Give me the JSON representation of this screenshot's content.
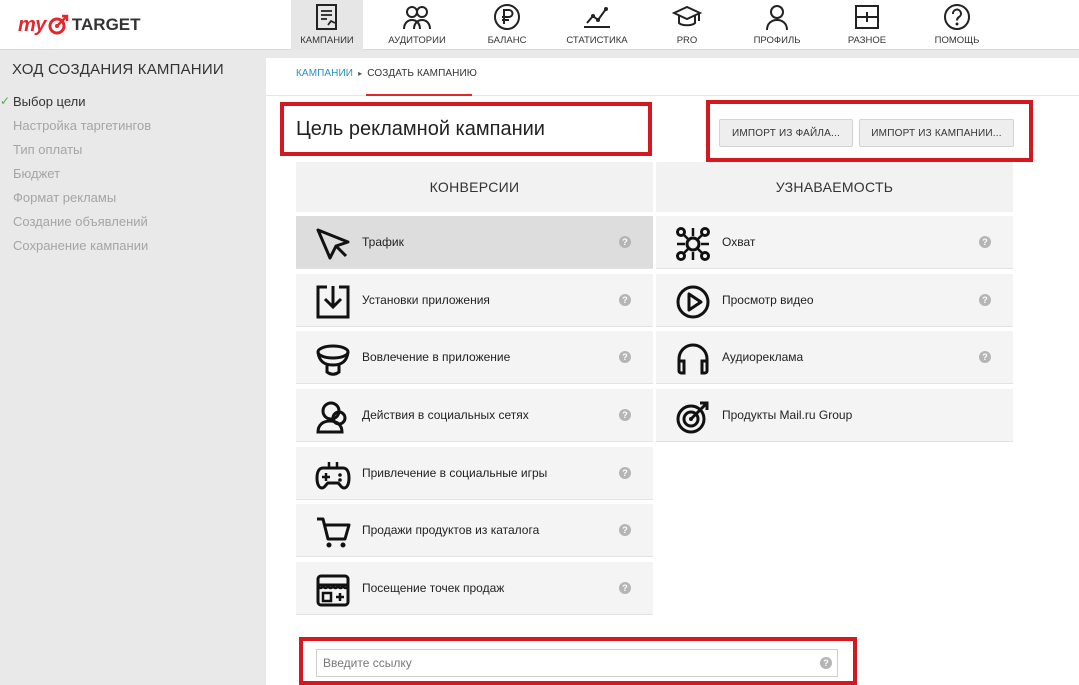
{
  "logo": {
    "my": "my",
    "target": "TARGET"
  },
  "nav": [
    {
      "label": "КАМПАНИИ",
      "icon": "campaigns-icon"
    },
    {
      "label": "АУДИТОРИИ",
      "icon": "audiences-icon"
    },
    {
      "label": "БАЛАНС",
      "icon": "ruble-icon"
    },
    {
      "label": "СТАТИСТИКА",
      "icon": "statistics-icon"
    },
    {
      "label": "PRO",
      "icon": "graduation-cap-icon"
    },
    {
      "label": "ПРОФИЛЬ",
      "icon": "profile-icon"
    },
    {
      "label": "РАЗНОЕ",
      "icon": "misc-icon"
    },
    {
      "label": "ПОМОЩЬ",
      "icon": "help-icon"
    }
  ],
  "sidebar": {
    "title": "ХОД СОЗДАНИЯ КАМПАНИИ",
    "steps": [
      {
        "label": "Выбор цели",
        "done": true
      },
      {
        "label": "Настройка таргетингов",
        "done": false
      },
      {
        "label": "Тип оплаты",
        "done": false
      },
      {
        "label": "Бюджет",
        "done": false
      },
      {
        "label": "Формат рекламы",
        "done": false
      },
      {
        "label": "Создание объявлений",
        "done": false
      },
      {
        "label": "Сохранение кампании",
        "done": false
      }
    ]
  },
  "breadcrumb": {
    "link": "КАМПАНИИ",
    "current": "СОЗДАТЬ КАМПАНИЮ"
  },
  "main": {
    "title": "Цель рекламной кампании",
    "import_file": "ИМПОРТ ИЗ ФАЙЛА...",
    "import_campaign": "ИМПОРТ ИЗ КАМПАНИИ..."
  },
  "columns": {
    "conversions": {
      "header": "КОНВЕРСИИ",
      "items": [
        {
          "label": "Трафик",
          "icon": "cursor-icon",
          "selected": true
        },
        {
          "label": "Установки приложения",
          "icon": "download-icon"
        },
        {
          "label": "Вовлечение в приложение",
          "icon": "engagement-icon"
        },
        {
          "label": "Действия в социальных сетях",
          "icon": "social-icon"
        },
        {
          "label": "Привлечение в социальные игры",
          "icon": "gamepad-icon"
        },
        {
          "label": "Продажи продуктов из каталога",
          "icon": "cart-icon"
        },
        {
          "label": "Посещение точек продаж",
          "icon": "store-icon"
        }
      ]
    },
    "awareness": {
      "header": "УЗНАВАЕМОСТЬ",
      "items": [
        {
          "label": "Охват",
          "icon": "reach-icon"
        },
        {
          "label": "Просмотр видео",
          "icon": "play-icon"
        },
        {
          "label": "Аудиореклама",
          "icon": "headphones-icon"
        },
        {
          "label": "Продукты Mail.ru Group",
          "icon": "target-icon"
        }
      ]
    }
  },
  "help_glyph": "?",
  "link_input": {
    "placeholder": "Введите ссылку",
    "value": ""
  },
  "colors": {
    "accent": "#e5262b",
    "highlight": "#d4181f",
    "link": "#2a8fbd"
  }
}
